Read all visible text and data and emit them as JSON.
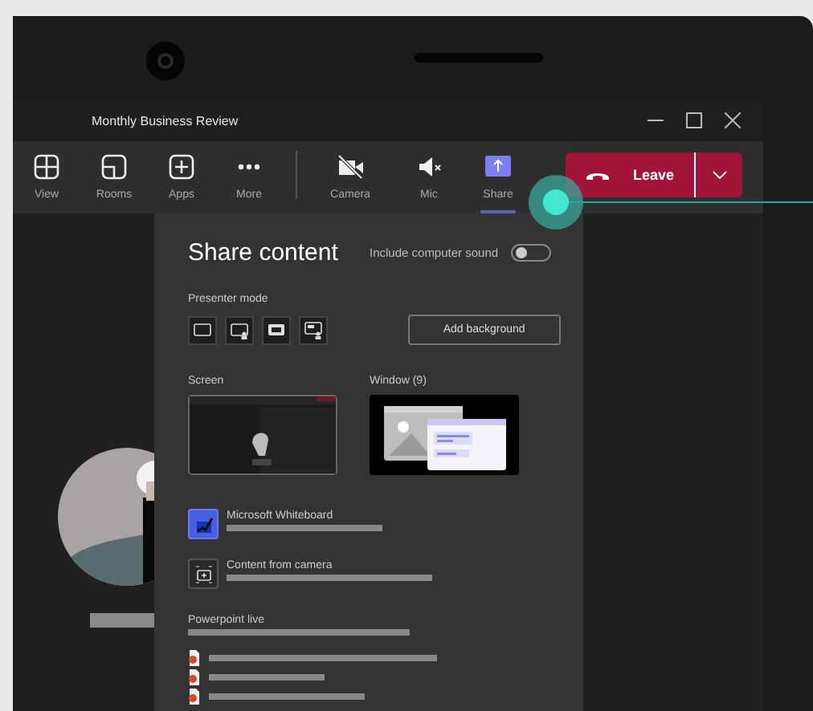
{
  "window": {
    "title": "Monthly Business Review"
  },
  "toolbar": {
    "items": [
      {
        "label": "View",
        "selected": false
      },
      {
        "label": "Rooms",
        "selected": false
      },
      {
        "label": "Apps",
        "selected": false
      },
      {
        "label": "More",
        "selected": false
      },
      {
        "label": "Camera",
        "selected": false
      },
      {
        "label": "Mic",
        "selected": false
      },
      {
        "label": "Share",
        "selected": true
      }
    ],
    "leave_button": {
      "label": "Leave"
    }
  },
  "share_panel": {
    "title": "Share content",
    "computer_sound": {
      "label": "Include computer sound",
      "on": false
    },
    "presenter_mode": {
      "label": "Presenter mode",
      "add_background": "Add background"
    },
    "screen": {
      "label": "Screen"
    },
    "window": {
      "label": "Window (9)"
    },
    "apps": [
      {
        "label": "Microsoft Whiteboard"
      },
      {
        "label": "Content from camera"
      }
    ],
    "powerpoint": {
      "label": "Powerpoint live"
    }
  }
}
